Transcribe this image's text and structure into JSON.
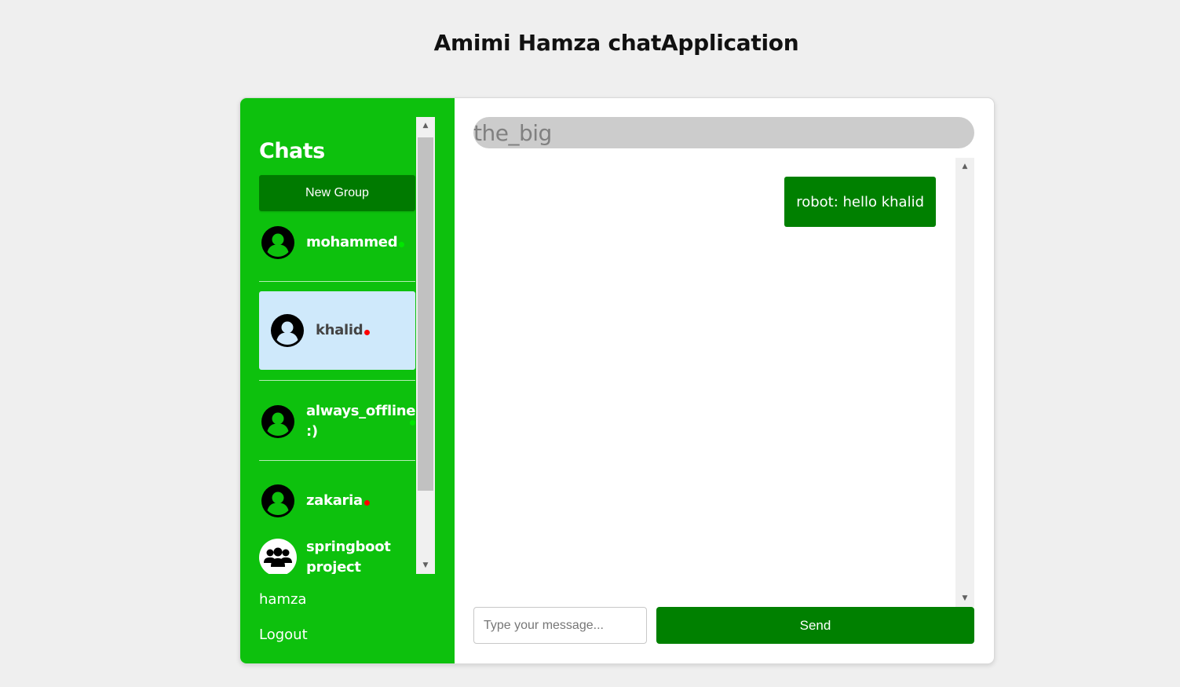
{
  "page": {
    "title": "Amimi Hamza chatApplication"
  },
  "sidebar": {
    "heading": "Chats",
    "new_group_label": "New Group",
    "contacts": [
      {
        "name": "mohammed",
        "status": "online",
        "icon": "user-avatar-icon"
      },
      {
        "name": "khalid",
        "status": "offline",
        "icon": "user-avatar-icon",
        "selected": true
      },
      {
        "name": "always_offline :)",
        "status": "online",
        "icon": "user-avatar-icon"
      },
      {
        "name": "zakaria",
        "status": "offline",
        "icon": "user-avatar-icon"
      },
      {
        "name": "springboot project",
        "status": "group",
        "icon": "group-avatar-icon"
      }
    ],
    "current_user": "hamza",
    "logout_label": "Logout"
  },
  "chat": {
    "header": "the_big",
    "messages": [
      {
        "text": "robot: hello khalid"
      }
    ],
    "input_placeholder": "Type your message...",
    "send_label": "Send"
  },
  "colors": {
    "sidebar_bg": "#0dc10d",
    "button_dark_green": "#007a00",
    "message_bubble": "#008000",
    "online_dot": "#00e600",
    "offline_dot": "#ff0000",
    "selected_bg": "#cfe9fb",
    "header_pill": "#cccccc"
  }
}
